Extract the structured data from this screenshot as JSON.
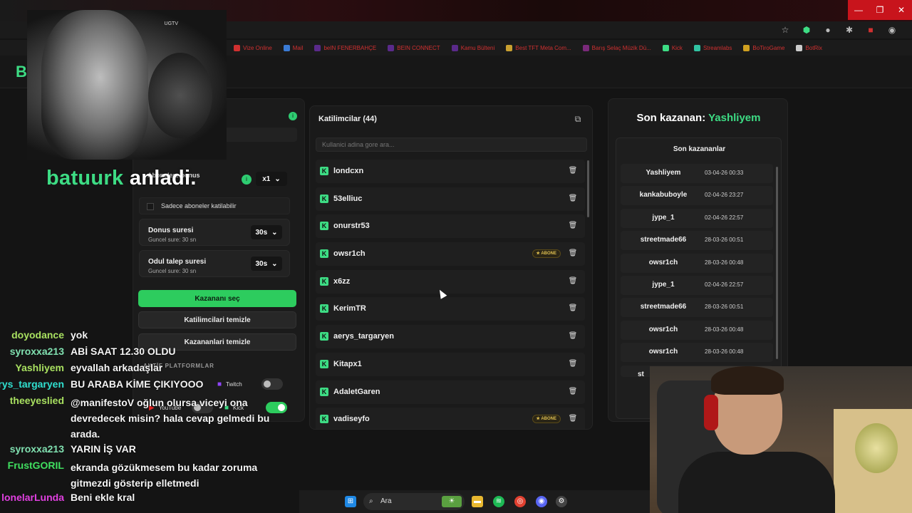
{
  "bookmarks": [
    {
      "label": "Vize Online",
      "color": "#d03030"
    },
    {
      "label": "Mail",
      "color": "#3a7bd5"
    },
    {
      "label": "beIN FENERBAHÇE",
      "color": "#5a2a8a"
    },
    {
      "label": "BEIN CONNECT",
      "color": "#5a2a8a"
    },
    {
      "label": "Kamu Bülteni",
      "color": "#5a2a8a"
    },
    {
      "label": "Best TFT Meta Com...",
      "color": "#c9a030"
    },
    {
      "label": "Barış Selaç Müzik Dü...",
      "color": "#7a2a7a"
    },
    {
      "label": "Kick",
      "color": "#3ddc84"
    },
    {
      "label": "Streamlabs",
      "color": "#31c3a2"
    },
    {
      "label": "BoTiroGame",
      "color": "#d0a020"
    },
    {
      "label": "BotRix",
      "color": "#cccccc"
    }
  ],
  "site": {
    "logo": "B"
  },
  "webcam_logo": "UGTV",
  "overlay": {
    "user": "batuurk",
    "message": "anladi."
  },
  "left_panel": {
    "subscriber_bonus_label": "Abonelere bonus",
    "subscriber_bonus_value": "x1",
    "only_subs_label": "Sadece aboneler katilabilir",
    "spin_title": "Donus suresi",
    "spin_sub": "Guncel sure: 30 sn",
    "spin_value": "30s",
    "claim_title": "Odul talep suresi",
    "claim_sub": "Guncel sure: 30 sn",
    "claim_value": "30s",
    "btn_pick_winner": "Kazananı seç",
    "btn_clear_participants": "Katilimcilari temizle",
    "btn_clear_winners": "Kazananlari temizle",
    "platforms_title": "AKTİF PLATFORMLAR",
    "platforms": [
      {
        "name": "Twitch",
        "on": false
      },
      {
        "name": "YouTube",
        "on": false
      },
      {
        "name": "Kick",
        "on": true
      }
    ]
  },
  "participants": {
    "title": "Katilimcilar (44)",
    "search_placeholder": "Kullanici adina gore ara...",
    "abone_label": "ABONE",
    "items": [
      {
        "name": "londcxn",
        "abone": false
      },
      {
        "name": "53elliuc",
        "abone": false
      },
      {
        "name": "onurstr53",
        "abone": false
      },
      {
        "name": "owsr1ch",
        "abone": true
      },
      {
        "name": "x6zz",
        "abone": false
      },
      {
        "name": "KerimTR",
        "abone": false
      },
      {
        "name": "aerys_targaryen",
        "abone": false
      },
      {
        "name": "Kitapx1",
        "abone": false
      },
      {
        "name": "AdaletGaren",
        "abone": false
      },
      {
        "name": "vadiseyfo",
        "abone": true
      }
    ]
  },
  "winners": {
    "title_prefix": "Son kazanan:",
    "title_winner": "Yashliyem",
    "list_title": "Son kazananlar",
    "items": [
      {
        "name": "Yashliyem",
        "date": "03-04-26 00:33"
      },
      {
        "name": "kankabuboyle",
        "date": "02-04-26 23:27"
      },
      {
        "name": "jype_1",
        "date": "02-04-26 22:57"
      },
      {
        "name": "streetmade66",
        "date": "28-03-26 00:51"
      },
      {
        "name": "owsr1ch",
        "date": "28-03-26 00:48"
      },
      {
        "name": "jype_1",
        "date": "02-04-26 22:57"
      },
      {
        "name": "streetmade66",
        "date": "28-03-26 00:51"
      },
      {
        "name": "owsr1ch",
        "date": "28-03-26 00:48"
      },
      {
        "name": "owsr1ch",
        "date": "28-03-26 00:48"
      }
    ],
    "cut_label": "st"
  },
  "chat": [
    {
      "user": "doyodance",
      "color": "#a8e060",
      "msg": "yok"
    },
    {
      "user": "syroxxa213",
      "color": "#80e0b0",
      "msg": "ABİ SAAT 12.30 OLDU"
    },
    {
      "user": "Yashliyem",
      "color": "#a8e060",
      "msg": "eyvallah arkadaşlar"
    },
    {
      "user": "aerys_targaryen",
      "color": "#30e0d0",
      "msg": "BU ARABA KİME ÇIKIYOOO"
    },
    {
      "user": "theeyeslied",
      "color": "#a8e060",
      "msg": "@manifestoV oğlun olursa viceyi ona devredecek misin? hala cevap gelmedi bu arada."
    },
    {
      "user": "syroxxa213",
      "color": "#80e0b0",
      "msg": "YARIN İŞ VAR"
    },
    {
      "user": "FrustGORIL",
      "color": "#40e060",
      "msg": "ekranda gözükmesem bu kadar zoruma gitmezdi gösterip elletmedi"
    },
    {
      "user": "lonelarLunda",
      "color": "#e040e0",
      "msg": "Beni ekle kral"
    }
  ],
  "taskbar": {
    "search_label": "Ara"
  }
}
